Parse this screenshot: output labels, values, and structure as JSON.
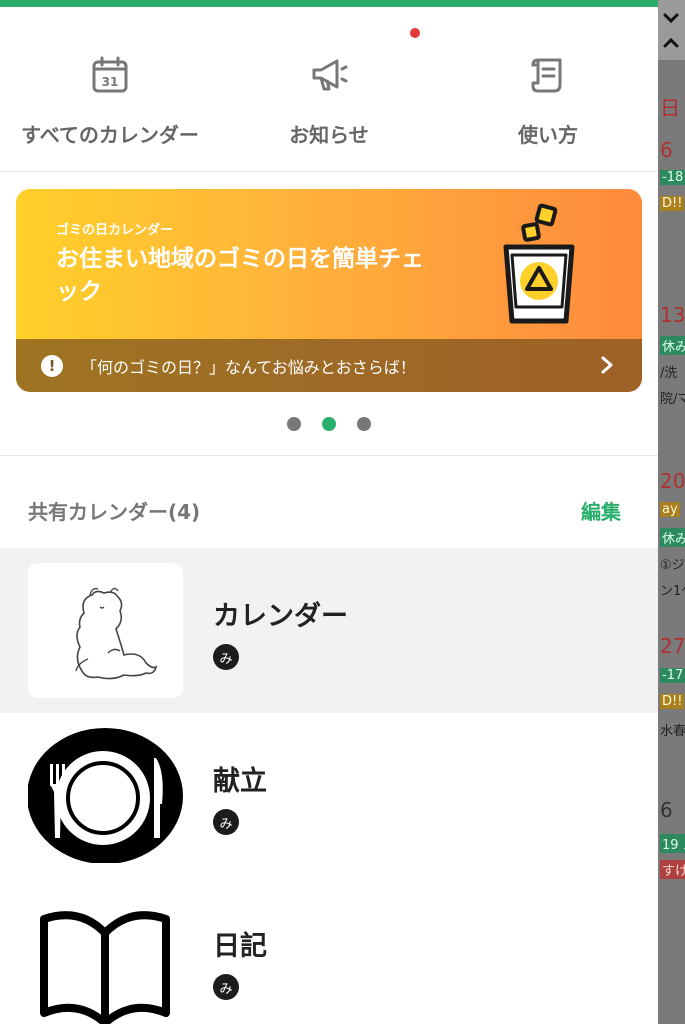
{
  "quick_menu": {
    "calendar_day": "31",
    "all_calendars": "すべてのカレンダー",
    "news": "お知らせ",
    "how_to": "使い方"
  },
  "banner": {
    "small_label": "ゴミの日カレンダー",
    "title": "お住まい地域のゴミの日を簡単チェック",
    "footer_icon": "!",
    "footer_text": "「何のゴミの日？」なんてお悩みとおさらば！",
    "page_count": 3,
    "active_page": 2
  },
  "shared_section": {
    "title": "共有カレンダー(4)",
    "edit_label": "編集"
  },
  "calendars": [
    {
      "name": "カレンダー",
      "member": "み",
      "thumbnail": "moomin-sketch",
      "selected": true
    },
    {
      "name": "献立",
      "member": "み",
      "thumbnail": "plate-fork-knife-icon",
      "selected": false
    },
    {
      "name": "日記",
      "member": "み",
      "thumbnail": "open-book-icon",
      "selected": false
    }
  ],
  "background_calendar": {
    "header": "日",
    "dates": [
      "6",
      "13",
      "20",
      "27",
      "6"
    ],
    "events": [
      "-18",
      "D!!",
      "休み",
      "/洗",
      "院/マ",
      "ay",
      "休み",
      "①ジ",
      "ン1ケ",
      "-17",
      "D!!",
      "水春",
      "19 ス",
      "すけ"
    ]
  },
  "colors": {
    "accent_green": "#2aae6b",
    "notification_red": "#e53935",
    "banner_gradient_start": "#ffd02a",
    "banner_gradient_end": "#ff8a3c"
  }
}
